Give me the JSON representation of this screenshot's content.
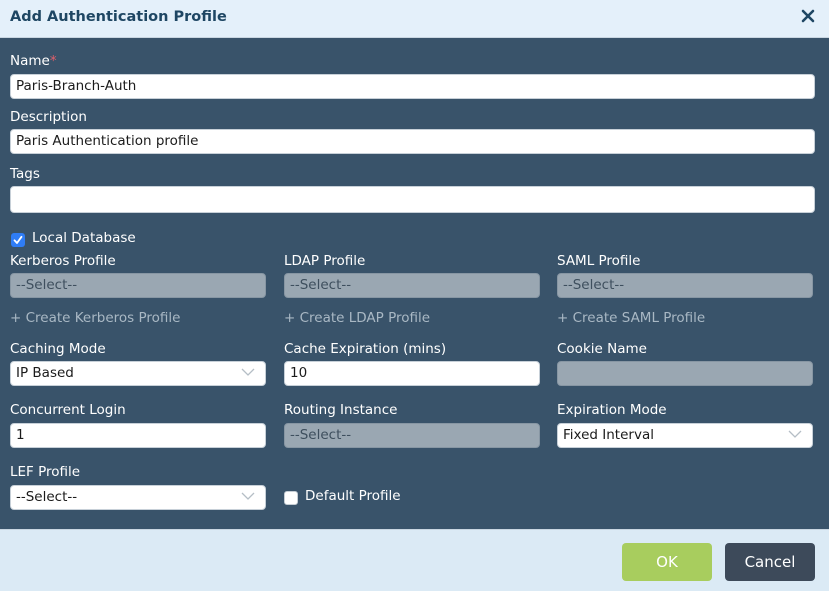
{
  "dialog": {
    "title": "Add Authentication Profile"
  },
  "fields": {
    "name": {
      "label": "Name",
      "required_mark": "*",
      "value": "Paris-Branch-Auth"
    },
    "description": {
      "label": "Description",
      "value": "Paris Authentication profile"
    },
    "tags": {
      "label": "Tags",
      "value": ""
    },
    "local_database": {
      "label": "Local Database",
      "checked": true
    },
    "kerberos_profile": {
      "label": "Kerberos Profile",
      "value": "--Select--",
      "create_link": "+ Create Kerberos Profile"
    },
    "ldap_profile": {
      "label": "LDAP Profile",
      "value": "--Select--",
      "create_link": "+ Create LDAP Profile"
    },
    "saml_profile": {
      "label": "SAML Profile",
      "value": "--Select--",
      "create_link": "+ Create SAML Profile"
    },
    "caching_mode": {
      "label": "Caching Mode",
      "value": "IP Based"
    },
    "cache_expiration": {
      "label": "Cache Expiration (mins)",
      "value": "10"
    },
    "cookie_name": {
      "label": "Cookie Name",
      "value": ""
    },
    "concurrent_login": {
      "label": "Concurrent Login",
      "value": "1"
    },
    "routing_instance": {
      "label": "Routing Instance",
      "value": "--Select--"
    },
    "expiration_mode": {
      "label": "Expiration Mode",
      "value": "Fixed Interval"
    },
    "lef_profile": {
      "label": "LEF Profile",
      "value": "--Select--"
    },
    "default_profile": {
      "label": "Default Profile",
      "checked": false
    }
  },
  "footer": {
    "ok_label": "OK",
    "cancel_label": "Cancel"
  },
  "colors": {
    "header_bg": "#e4f0fa",
    "body_bg": "#39536a",
    "ok_button": "#a8cd5e",
    "cancel_button": "#3d4a5a",
    "required_mark": "#e2606b",
    "checkbox_checked": "#2f7df6"
  }
}
